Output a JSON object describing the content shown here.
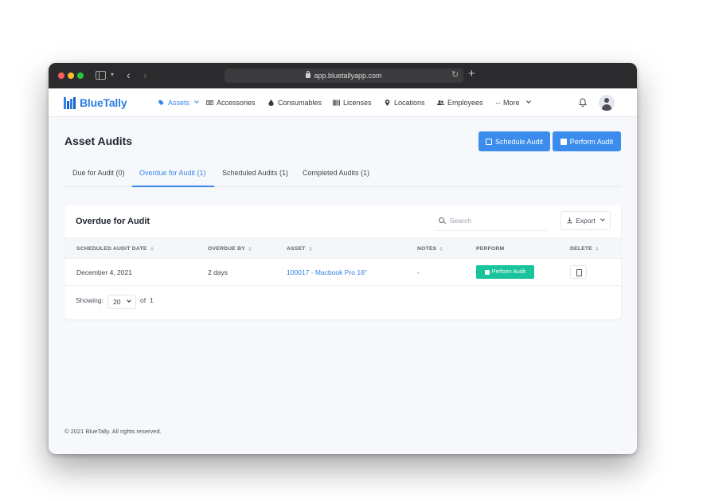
{
  "browser": {
    "url": "app.bluetallyapp.com"
  },
  "app": {
    "brand": "BlueTally",
    "accent": "#2f80ed",
    "success": "#19c39b"
  },
  "nav": {
    "items": [
      {
        "label": "Assets",
        "icon": "tag-icon",
        "active": true,
        "has_dropdown": true
      },
      {
        "label": "Accessories",
        "icon": "keyboard-icon"
      },
      {
        "label": "Consumables",
        "icon": "droplet-icon"
      },
      {
        "label": "Licenses",
        "icon": "barcode-icon"
      },
      {
        "label": "Locations",
        "icon": "location-pin-icon"
      },
      {
        "label": "Employees",
        "icon": "users-icon"
      },
      {
        "label": "More",
        "icon": "ellipsis-icon",
        "has_dropdown": true
      }
    ]
  },
  "page": {
    "title": "Asset Audits",
    "schedule_label": "Schedule Audit",
    "perform_label": "Perform Audit"
  },
  "tabs": [
    {
      "label": "Due for Audit (0)"
    },
    {
      "label": "Overdue for Audit (1)",
      "active": true
    },
    {
      "label": "Scheduled Audits (1)"
    },
    {
      "label": "Completed Audits (1)"
    }
  ],
  "card": {
    "title": "Overdue for Audit",
    "search_placeholder": "Search",
    "export_label": "Export"
  },
  "table": {
    "columns": [
      "SCHEDULED AUDIT DATE",
      "OVERDUE BY",
      "ASSET",
      "NOTES",
      "PERFORM",
      "DELETE"
    ],
    "rows": [
      {
        "date": "December 4, 2021",
        "overdue": "2 days",
        "asset": "100017 - Macbook Pro 16\"",
        "notes": "-",
        "perform_label": "Perform Audit"
      }
    ]
  },
  "pagination": {
    "showing_label": "Showing:",
    "page_size": "20",
    "of_label": "of",
    "total_pages": "1"
  },
  "footer": {
    "text": "© 2021 BlueTally. All rights reserved."
  }
}
